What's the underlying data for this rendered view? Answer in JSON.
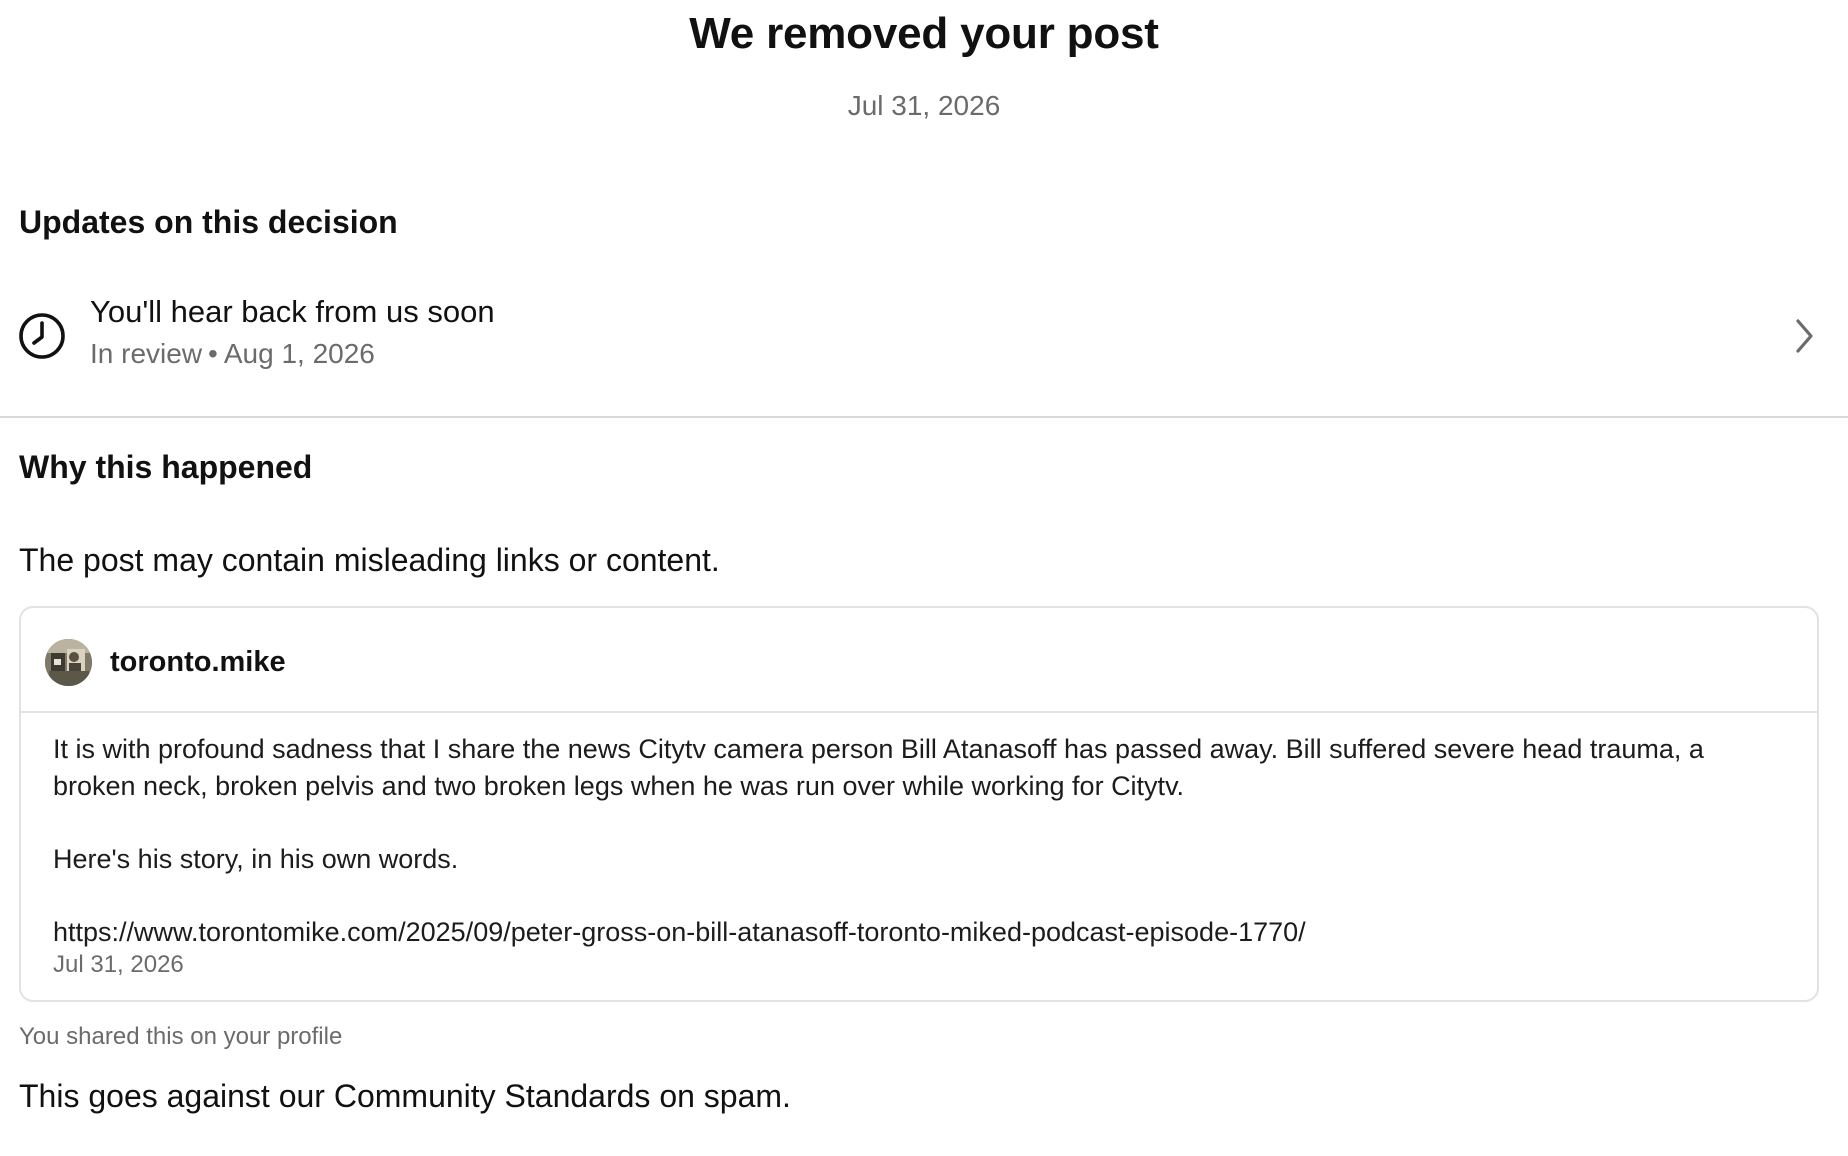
{
  "page": {
    "title": "We removed your post",
    "date": "Jul 31, 2026"
  },
  "updates": {
    "heading": "Updates on this decision",
    "item": {
      "icon": "clock-icon",
      "title": "You'll hear back from us soon",
      "status": "In review",
      "separator": "•",
      "date": "Aug 1, 2026",
      "chevron": "chevron-right-icon"
    }
  },
  "why": {
    "heading": "Why this happened",
    "reason": "The post may contain misleading links or content."
  },
  "post": {
    "author": "toronto.mike",
    "paragraph1": "It is with profound sadness that I share the news Citytv camera person Bill Atanasoff has passed away. Bill suffered severe head trauma, a broken neck, broken pelvis and two broken legs when he was run over while working for Citytv.",
    "paragraph2": "Here's his story, in his own words.",
    "link": "https://www.torontomike.com/2025/09/peter-gross-on-bill-atanasoff-toronto-miked-podcast-episode-1770/",
    "date": "Jul 31, 2026"
  },
  "shared_note": "You shared this on your profile",
  "standards_text": "This goes against our Community Standards on spam.",
  "colors": {
    "text": "#111111",
    "secondary": "#6b6b6b",
    "divider": "#d9d9d9",
    "card_border": "#e2e2e2"
  }
}
